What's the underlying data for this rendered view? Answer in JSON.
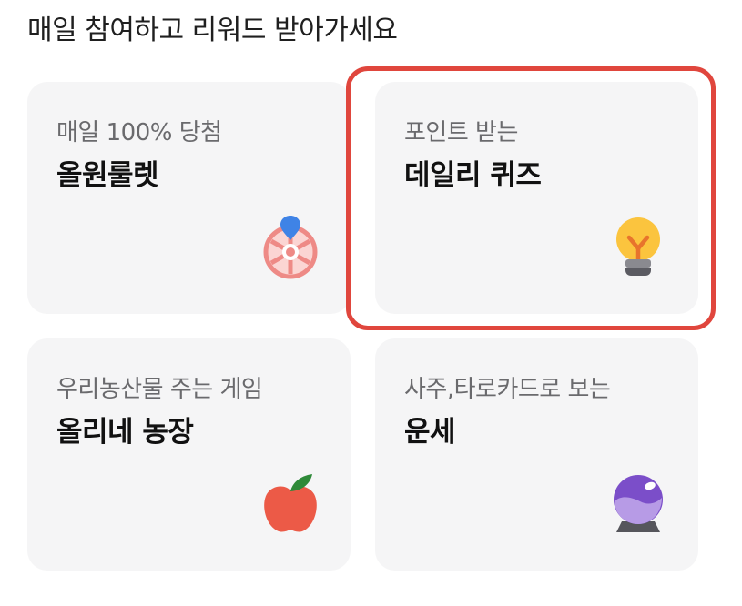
{
  "heading": "매일 참여하고 리워드 받아가세요",
  "cards": [
    {
      "sub": "매일 100% 당첨",
      "title": "올원룰렛",
      "icon": "roulette-icon"
    },
    {
      "sub": "포인트 받는",
      "title": "데일리 퀴즈",
      "icon": "lightbulb-icon",
      "highlighted": true
    },
    {
      "sub": "우리농산물 주는 게임",
      "title": "올리네 농장",
      "icon": "apple-icon"
    },
    {
      "sub": "사주,타로카드로 보는",
      "title": "운세",
      "icon": "crystal-ball-icon"
    }
  ],
  "colors": {
    "card_background": "#f5f5f6",
    "highlight_border": "#e0463d"
  }
}
